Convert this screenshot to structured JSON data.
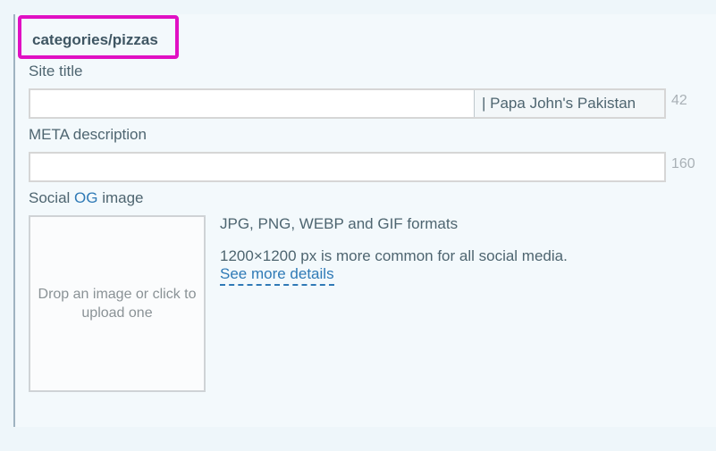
{
  "breadcrumb": {
    "path": "categories/pizzas"
  },
  "site_title": {
    "label": "Site title",
    "value": "",
    "suffix": "| Papa John's Pakistan",
    "counter": "42"
  },
  "meta_description": {
    "label": "META description",
    "value": "",
    "counter": "160"
  },
  "social_og": {
    "label_prefix": "Social ",
    "label_accent": "OG",
    "label_suffix": " image",
    "dropzone_text": "Drop an image or click to upload one",
    "formats": "JPG, PNG, WEBP and GIF formats",
    "size_hint": "1200×1200 px is more common for all social media.",
    "details_link": "See more details"
  },
  "colors": {
    "highlight_border": "#e010c3",
    "accent": "#2f7ab6",
    "text": "#4e6570"
  }
}
